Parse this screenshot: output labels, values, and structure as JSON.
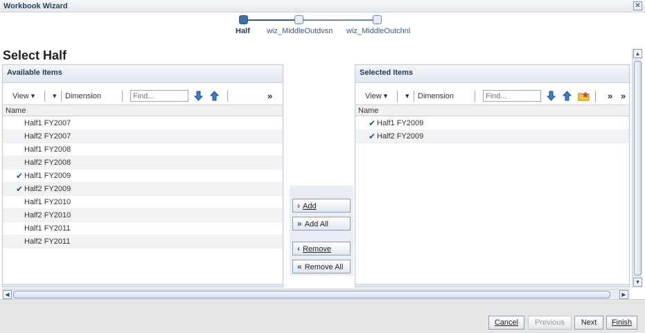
{
  "window": {
    "title": "Workbook Wizard",
    "close_glyph": "✕"
  },
  "train": {
    "steps": [
      {
        "label": "Half",
        "current": true
      },
      {
        "label": "wiz_MiddleOutdvsn",
        "current": false
      },
      {
        "label": "wiz_MiddleOutchnl",
        "current": false
      }
    ]
  },
  "page": {
    "heading": "Select Half"
  },
  "available": {
    "title": "Available Items",
    "view_label": "View ▾",
    "dimension_label": "Dimension",
    "find_placeholder": "Find...",
    "column": "Name",
    "rows": [
      {
        "label": "Half1 FY2007",
        "checked": false
      },
      {
        "label": "Half2 FY2007",
        "checked": false
      },
      {
        "label": "Half1 FY2008",
        "checked": false
      },
      {
        "label": "Half2 FY2008",
        "checked": false
      },
      {
        "label": "Half1 FY2009",
        "checked": true
      },
      {
        "label": "Half2 FY2009",
        "checked": true
      },
      {
        "label": "Half1 FY2010",
        "checked": false
      },
      {
        "label": "Half2 FY2010",
        "checked": false
      },
      {
        "label": "Half1 FY2011",
        "checked": false
      },
      {
        "label": "Half2 FY2011",
        "checked": false
      }
    ]
  },
  "selected": {
    "title": "Selected Items",
    "view_label": "View ▾",
    "dimension_label": "Dimension",
    "find_placeholder": "Find...",
    "column": "Name",
    "rows": [
      {
        "label": "Half1 FY2009",
        "checked": true
      },
      {
        "label": "Half2 FY2009",
        "checked": true
      }
    ]
  },
  "shuttle": {
    "add": "Add",
    "add_all": "Add All",
    "remove": "Remove",
    "remove_all": "Remove All"
  },
  "footer": {
    "cancel": "Cancel",
    "previous": "Previous",
    "next": "Next",
    "finish": "Finish"
  },
  "colors": {
    "accent": "#2c5a8a",
    "check": "#1f4f8a",
    "footer_bg": "#e5e5e5"
  }
}
